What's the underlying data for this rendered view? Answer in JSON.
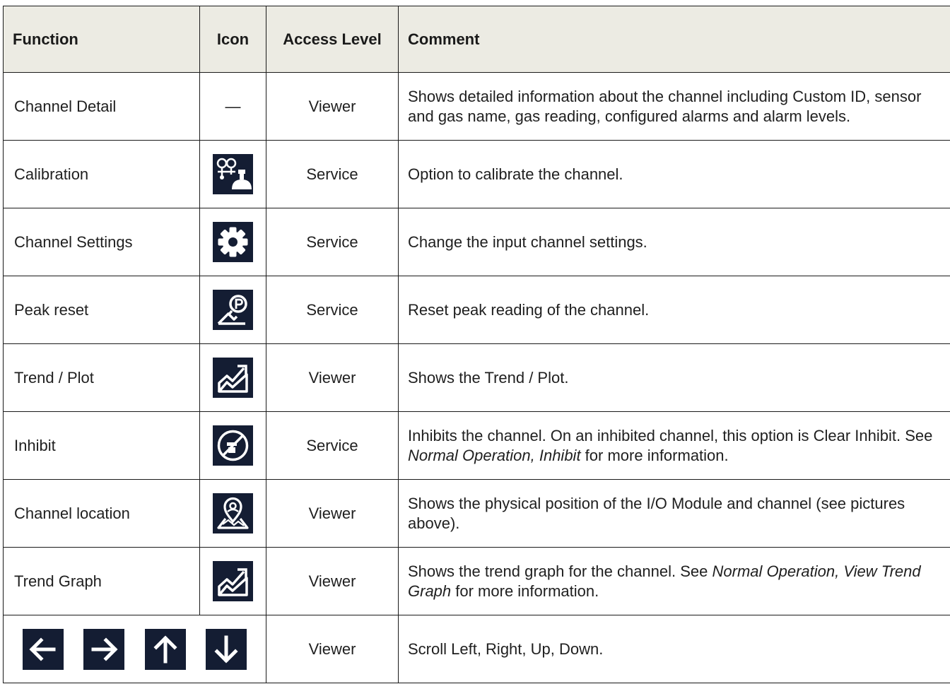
{
  "headers": {
    "function": "Function",
    "icon": "Icon",
    "access": "Access Level",
    "comment": "Comment"
  },
  "rows": [
    {
      "function": "Channel Detail",
      "icon_text": "—",
      "icon": "none",
      "access": "Viewer",
      "comment": "Shows detailed information about the channel including Custom ID, sensor and gas name, gas reading, configured alarms and alarm levels."
    },
    {
      "function": "Calibration",
      "icon": "calibration-icon",
      "access": "Service",
      "comment": "Option to calibrate the channel."
    },
    {
      "function": "Channel Settings",
      "icon": "gear-icon",
      "access": "Service",
      "comment": "Change the input channel settings."
    },
    {
      "function": "Peak reset",
      "icon": "peak-reset-icon",
      "access": "Service",
      "comment": "Reset peak reading of the channel."
    },
    {
      "function": "Trend / Plot",
      "icon": "trend-icon",
      "access": "Viewer",
      "comment": "Shows the Trend / Plot."
    },
    {
      "function": "Inhibit",
      "icon": "inhibit-icon",
      "access": "Service",
      "comment_pre": "Inhibits the channel. On an inhibited channel, this option is Clear Inhibit. See ",
      "comment_em": "Normal Operation, Inhibit",
      "comment_post": " for more information."
    },
    {
      "function": "Channel location",
      "icon": "location-icon",
      "access": "Viewer",
      "comment": "Shows the physical position of the I/O Module and channel (see pictures above)."
    },
    {
      "function": "Trend Graph",
      "icon": "trend-graph-icon",
      "access": "Viewer",
      "comment_pre": "Shows the trend graph for the channel. See ",
      "comment_em": "Normal Operation, View Trend Graph",
      "comment_post": " for more information."
    },
    {
      "icons": [
        "arrow-left-icon",
        "arrow-right-icon",
        "arrow-up-icon",
        "arrow-down-icon"
      ],
      "access": "Viewer",
      "comment": "Scroll Left, Right, Up, Down."
    }
  ],
  "colors": {
    "header_bg": "#ecebe3",
    "icon_bg": "#141d33",
    "border": "#1a1a1a"
  }
}
